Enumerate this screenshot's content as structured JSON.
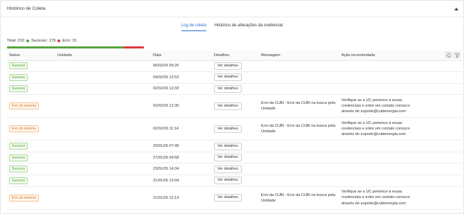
{
  "panel": {
    "title": "Histórico de Coleta"
  },
  "tabs": [
    {
      "label": "Log de coleta",
      "active": true
    },
    {
      "label": "Histórico de alterações da credencial",
      "active": false
    }
  ],
  "summary": {
    "total_label": "Total: 210",
    "success_label": "Sucesso: 179",
    "error_label": "Erro: 31",
    "success_count": 179,
    "error_count": 31,
    "total_count": 210,
    "success_color": "#52a43a",
    "error_color": "#d9363e"
  },
  "table": {
    "headers": {
      "status": "Status",
      "unidade": "Unidade",
      "data": "Data",
      "detalhes": "Detalhes",
      "mensagem": "Mensagem",
      "acao": "Ação recomendada"
    },
    "details_button_label": "Ver detalhes",
    "rows": [
      {
        "status": "Sucesso",
        "type": "ok",
        "unidade": "",
        "data": "06/02/26 09:20",
        "mensagem": "",
        "acao": ""
      },
      {
        "status": "Sucesso",
        "type": "ok",
        "unidade": "",
        "data": "04/02/26 12:52",
        "mensagem": "",
        "acao": ""
      },
      {
        "status": "Sucesso",
        "type": "ok",
        "unidade": "",
        "data": "02/02/26 12:33",
        "mensagem": "",
        "acao": ""
      },
      {
        "status": "Erro do sistema",
        "type": "err",
        "unidade": "",
        "data": "02/02/26 12:30",
        "mensagem": "Erro da CUBi - Erro da CUBi na busca pela Unidade",
        "acao": "Verifique se a UC pertence à essas credenciais e entre em contato conosco através do suporte@cubienergia.com"
      },
      {
        "status": "Erro do sistema",
        "type": "err",
        "unidade": "",
        "data": "02/02/26 11:14",
        "mensagem": "Erro da CUBi - Erro da CUBi na busca pela Unidade",
        "acao": "Verifique se a UC pertence à essas credenciais e entre em contato conosco através do suporte@cubienergia.com"
      },
      {
        "status": "Sucesso",
        "type": "ok",
        "unidade": "",
        "data": "29/01/26 07:49",
        "mensagem": "",
        "acao": ""
      },
      {
        "status": "Sucesso",
        "type": "ok",
        "unidade": "",
        "data": "27/01/26 04:58",
        "mensagem": "",
        "acao": ""
      },
      {
        "status": "Sucesso",
        "type": "ok",
        "unidade": "",
        "data": "23/01/26 14:34",
        "mensagem": "",
        "acao": ""
      },
      {
        "status": "Sucesso",
        "type": "ok",
        "unidade": "",
        "data": "21/01/26 13:04",
        "mensagem": "",
        "acao": ""
      },
      {
        "status": "Erro do sistema",
        "type": "err",
        "unidade": "",
        "data": "21/01/26 12:13",
        "mensagem": "Erro da CUBi - Erro da CUBi na busca pela Unidade",
        "acao": "Verifique se a UC pertence à essas credenciais e entre em contato conosco através do suporte@cubienergia.com"
      }
    ]
  },
  "icons": {
    "collapse": "chevron-up-icon",
    "reload": "reload-icon",
    "filter": "filter-icon"
  }
}
